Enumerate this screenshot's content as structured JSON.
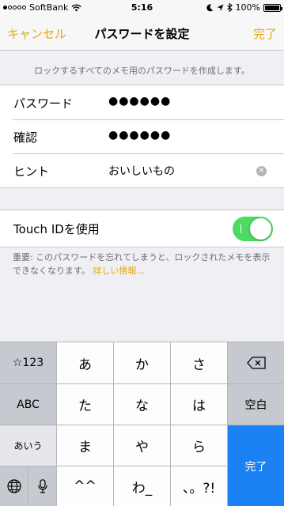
{
  "status_bar": {
    "carrier": "SoftBank",
    "time": "5:16",
    "battery_percent": "100%",
    "battery_level": 1.0
  },
  "nav": {
    "cancel_label": "キャンセル",
    "title": "パスワードを設定",
    "done_label": "完了"
  },
  "header_note": "ロックするすべてのメモ用のパスワードを作成します。",
  "form": {
    "password_label": "パスワード",
    "password_value": "●●●●●●",
    "confirm_label": "確認",
    "confirm_value": "●●●●●●",
    "hint_label": "ヒント",
    "hint_value": "おいしいもの"
  },
  "touch_id": {
    "label": "Touch IDを使用",
    "enabled": true
  },
  "footer_note": {
    "text": "重要: このパスワードを忘れてしまうと、ロックされたメモを表示できなくなります。",
    "link": "詳しい情報..."
  },
  "keyboard": {
    "symbols_key": "☆123",
    "abc_key": "ABC",
    "kana_key": "あいう",
    "char_keys": [
      "あ",
      "か",
      "さ",
      "た",
      "な",
      "は",
      "ま",
      "や",
      "ら",
      "^^",
      "わ_",
      "、。?!"
    ],
    "space_key": "空白",
    "done_key": "完了"
  },
  "colors": {
    "accent": "#e3a816",
    "toggle_on": "#4cd964",
    "keyboard_done": "#1a82f5"
  },
  "icons": [
    "wifi-icon",
    "moon-icon",
    "location-arrow-icon",
    "bluetooth-icon",
    "battery-icon",
    "clear-icon",
    "backspace-icon",
    "globe-icon",
    "microphone-icon"
  ]
}
